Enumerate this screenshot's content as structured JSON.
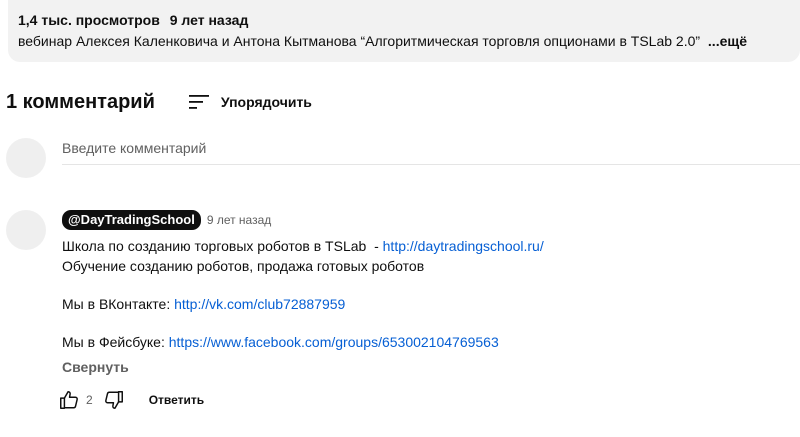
{
  "description": {
    "views": "1,4 тыс. просмотров",
    "age": "9 лет назад",
    "text": "вебинар Алексея Каленковича и Антона Кытманова “Алгоритмическая торговля опционами в TSLab 2.0”",
    "more_label": "...ещё"
  },
  "comments_header": {
    "count_label": "1 комментарий",
    "sort_label": "Упорядочить",
    "sort_icon": "sort-icon"
  },
  "comment_input": {
    "placeholder": "Введите комментарий"
  },
  "comment": {
    "author": "@DayTradingSchool",
    "time": "9 лет назад",
    "line1_text": "Школа по созданию торговых роботов в TSLab  - ",
    "line1_link": "http://daytradingschool.ru/",
    "line2_text": "Обучение созданию роботов, продажа готовых роботов",
    "line3_text": "Мы в ВКонтакте: ",
    "line3_link": "http://vk.com/club72887959",
    "line4_text": "Мы в Фейсбуке: ",
    "line4_link": "https://www.facebook.com/groups/653002104769563",
    "collapse_label": "Свернуть"
  },
  "actions": {
    "like_count": "2",
    "reply_label": "Ответить",
    "like_icon": "thumb-up-icon",
    "dislike_icon": "thumb-down-icon"
  },
  "colors": {
    "link": "#065fd4",
    "desc_background": "#f2f2f2",
    "secondary_text": "#606060"
  }
}
